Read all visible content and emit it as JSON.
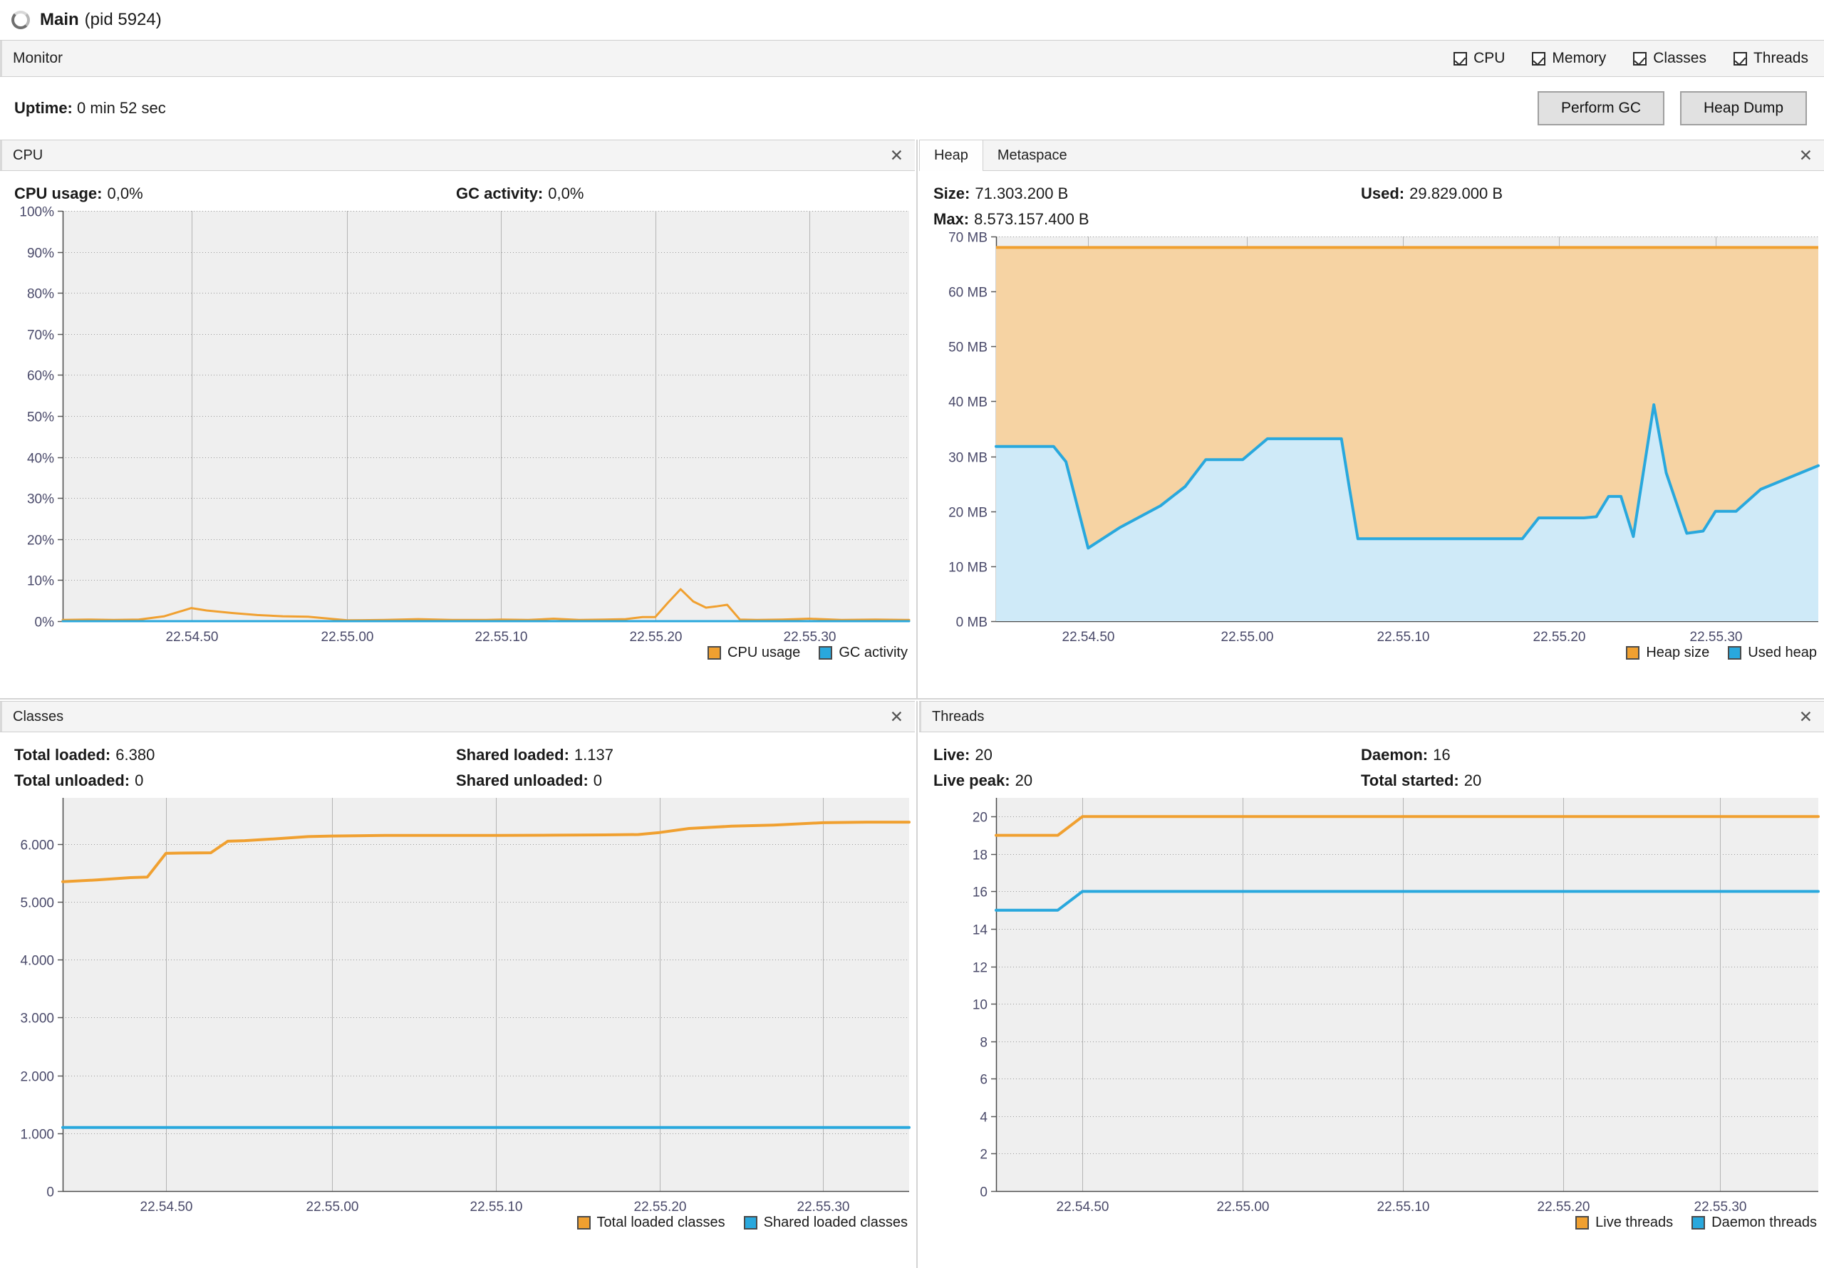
{
  "window": {
    "process_name": "Main",
    "pid_label": "(pid 5924)",
    "app_icon": "process-icon"
  },
  "toolbar": {
    "tab_label": "Monitor",
    "checkboxes": [
      {
        "label": "CPU",
        "checked": true
      },
      {
        "label": "Memory",
        "checked": true
      },
      {
        "label": "Classes",
        "checked": true
      },
      {
        "label": "Threads",
        "checked": true
      }
    ]
  },
  "uptime": {
    "label": "Uptime:",
    "value": "0 min 52 sec"
  },
  "actions": {
    "perform_gc": "Perform GC",
    "heap_dump": "Heap Dump"
  },
  "colors": {
    "orange_line": "#f0a030",
    "orange_fill": "#f6d3a3",
    "blue_line": "#29a8dd",
    "blue_fill": "#cfeaf8",
    "plot_bg": "#efefef",
    "grid": "#bbbbbb",
    "axis_text": "#4a4a6a"
  },
  "panels": {
    "cpu": {
      "title": "CPU",
      "close_icon": "close-icon",
      "stats": [
        {
          "label": "CPU usage:",
          "value": "0,0%"
        },
        {
          "label": "GC activity:",
          "value": "0,0%"
        }
      ],
      "legend": [
        {
          "label": "CPU usage",
          "color": "#f0a030"
        },
        {
          "label": "GC activity",
          "color": "#29a8dd"
        }
      ]
    },
    "heap": {
      "tabs": [
        {
          "label": "Heap",
          "active": true
        },
        {
          "label": "Metaspace",
          "active": false
        }
      ],
      "close_icon": "close-icon",
      "stats": [
        {
          "label": "Size:",
          "value": "71.303.200 B"
        },
        {
          "label": "Used:",
          "value": "29.829.000 B"
        },
        {
          "label": "Max:",
          "value": "8.573.157.400 B"
        }
      ],
      "legend": [
        {
          "label": "Heap size",
          "color": "#f0a030"
        },
        {
          "label": "Used heap",
          "color": "#29a8dd"
        }
      ]
    },
    "classes": {
      "title": "Classes",
      "close_icon": "close-icon",
      "stats": [
        {
          "label": "Total loaded:",
          "value": "6.380"
        },
        {
          "label": "Shared loaded:",
          "value": "1.137"
        },
        {
          "label": "Total unloaded:",
          "value": "0"
        },
        {
          "label": "Shared unloaded:",
          "value": "0"
        }
      ],
      "legend": [
        {
          "label": "Total loaded classes",
          "color": "#f0a030"
        },
        {
          "label": "Shared loaded classes",
          "color": "#29a8dd"
        }
      ]
    },
    "threads": {
      "title": "Threads",
      "close_icon": "close-icon",
      "stats": [
        {
          "label": "Live:",
          "value": "20"
        },
        {
          "label": "Daemon:",
          "value": "16"
        },
        {
          "label": "Live peak:",
          "value": "20"
        },
        {
          "label": "Total started:",
          "value": "20"
        }
      ],
      "legend": [
        {
          "label": "Live threads",
          "color": "#f0a030"
        },
        {
          "label": "Daemon threads",
          "color": "#29a8dd"
        }
      ]
    }
  },
  "chart_data": [
    {
      "id": "cpu",
      "type": "area",
      "title": "CPU",
      "xlabel": "",
      "ylabel": "",
      "ylim": [
        0,
        100
      ],
      "yticks": [
        0,
        10,
        20,
        30,
        40,
        50,
        60,
        70,
        80,
        90,
        100
      ],
      "ytick_labels": [
        "0%",
        "10%",
        "20%",
        "30%",
        "40%",
        "50%",
        "60%",
        "70%",
        "80%",
        "90%",
        "100%"
      ],
      "xtick_labels": [
        "22.54.50",
        "22.55.00",
        "22.55.10",
        "22.55.20",
        "22.55.30"
      ],
      "xtick_positions": [
        0.152,
        0.336,
        0.518,
        0.7,
        0.882
      ],
      "grid": true,
      "legend_position": "bottom-right",
      "series": [
        {
          "name": "CPU usage",
          "color": "#f0a030",
          "x": [
            0.0,
            0.03,
            0.06,
            0.09,
            0.12,
            0.152,
            0.17,
            0.2,
            0.23,
            0.26,
            0.29,
            0.336,
            0.38,
            0.42,
            0.46,
            0.5,
            0.518,
            0.55,
            0.58,
            0.61,
            0.64,
            0.665,
            0.685,
            0.7,
            0.715,
            0.73,
            0.745,
            0.76,
            0.772,
            0.785,
            0.8,
            0.82,
            0.85,
            0.882,
            0.92,
            0.96,
            1.0
          ],
          "values": [
            0.3,
            0.4,
            0.3,
            0.4,
            1.2,
            3.2,
            2.6,
            2.0,
            1.5,
            1.2,
            1.1,
            0.2,
            0.3,
            0.5,
            0.3,
            0.3,
            0.4,
            0.3,
            0.6,
            0.3,
            0.4,
            0.5,
            1.0,
            1.0,
            4.5,
            7.8,
            4.8,
            3.3,
            3.6,
            4.0,
            0.4,
            0.3,
            0.4,
            0.6,
            0.3,
            0.4,
            0.3
          ]
        },
        {
          "name": "GC activity",
          "color": "#29a8dd",
          "x": [
            0.0,
            1.0
          ],
          "values": [
            0.0,
            0.0
          ]
        }
      ]
    },
    {
      "id": "heap",
      "type": "area",
      "title": "Heap",
      "xlabel": "",
      "ylabel": "",
      "ylim": [
        0,
        70
      ],
      "yticks": [
        0,
        10,
        20,
        30,
        40,
        50,
        60,
        70
      ],
      "ytick_labels": [
        "0 MB",
        "10 MB",
        "20 MB",
        "30 MB",
        "40 MB",
        "50 MB",
        "60 MB",
        "70 MB"
      ],
      "xtick_labels": [
        "22.54.50",
        "22.55.00",
        "22.55.10",
        "22.55.20",
        "22.55.30"
      ],
      "xtick_positions": [
        0.112,
        0.305,
        0.495,
        0.685,
        0.875
      ],
      "grid": true,
      "legend_position": "bottom-right",
      "series": [
        {
          "name": "Heap size",
          "color": "#f0a030",
          "fill": "#f6d3a3",
          "x": [
            0.0,
            1.0
          ],
          "values": [
            68.0,
            68.0
          ]
        },
        {
          "name": "Used heap",
          "color": "#29a8dd",
          "fill": "#cfeaf8",
          "x": [
            0.0,
            0.07,
            0.085,
            0.112,
            0.15,
            0.2,
            0.23,
            0.255,
            0.3,
            0.33,
            0.345,
            0.42,
            0.43,
            0.44,
            0.495,
            0.53,
            0.56,
            0.64,
            0.66,
            0.685,
            0.7,
            0.715,
            0.73,
            0.745,
            0.76,
            0.775,
            0.8,
            0.815,
            0.84,
            0.86,
            0.875,
            0.9,
            0.93,
            1.0
          ],
          "values": [
            31.8,
            31.8,
            29.0,
            13.3,
            17.0,
            21.0,
            24.5,
            29.4,
            29.4,
            33.2,
            33.2,
            33.2,
            24.0,
            15.0,
            15.0,
            15.0,
            15.0,
            15.0,
            18.8,
            18.8,
            18.8,
            18.8,
            19.0,
            22.7,
            22.7,
            15.4,
            39.4,
            27.0,
            16.0,
            16.4,
            20.0,
            20.0,
            24.0,
            28.3
          ]
        }
      ]
    },
    {
      "id": "classes",
      "type": "line",
      "title": "Classes",
      "xlabel": "",
      "ylabel": "",
      "ylim": [
        0,
        6800
      ],
      "yticks": [
        0,
        1000,
        2000,
        3000,
        4000,
        5000,
        6000
      ],
      "ytick_labels": [
        "0",
        "1.000",
        "2.000",
        "3.000",
        "4.000",
        "5.000",
        "6.000"
      ],
      "xtick_labels": [
        "22.54.50",
        "22.55.00",
        "22.55.10",
        "22.55.20",
        "22.55.30"
      ],
      "xtick_positions": [
        0.122,
        0.318,
        0.512,
        0.705,
        0.898
      ],
      "grid": true,
      "legend_position": "bottom-right",
      "series": [
        {
          "name": "Total loaded classes",
          "color": "#f0a030",
          "x": [
            0.0,
            0.04,
            0.08,
            0.1,
            0.122,
            0.14,
            0.175,
            0.195,
            0.215,
            0.25,
            0.29,
            0.318,
            0.38,
            0.44,
            0.512,
            0.58,
            0.64,
            0.68,
            0.705,
            0.74,
            0.79,
            0.84,
            0.898,
            0.95,
            1.0
          ],
          "values": [
            5350,
            5380,
            5420,
            5430,
            5840,
            5845,
            5850,
            6050,
            6060,
            6090,
            6130,
            6140,
            6150,
            6150,
            6150,
            6155,
            6160,
            6165,
            6200,
            6270,
            6310,
            6330,
            6370,
            6380,
            6380
          ]
        },
        {
          "name": "Shared loaded classes",
          "color": "#29a8dd",
          "x": [
            0.0,
            1.0
          ],
          "values": [
            1100,
            1100
          ]
        }
      ]
    },
    {
      "id": "threads",
      "type": "line",
      "title": "Threads",
      "xlabel": "",
      "ylabel": "",
      "ylim": [
        0,
        21
      ],
      "yticks": [
        0,
        2,
        4,
        6,
        8,
        10,
        12,
        14,
        16,
        18,
        20
      ],
      "ytick_labels": [
        "0",
        "2",
        "4",
        "6",
        "8",
        "10",
        "12",
        "14",
        "16",
        "18",
        "20"
      ],
      "xtick_labels": [
        "22.54.50",
        "22.55.00",
        "22.55.10",
        "22.55.20",
        "22.55.30"
      ],
      "xtick_positions": [
        0.105,
        0.3,
        0.495,
        0.69,
        0.88
      ],
      "grid": true,
      "legend_position": "bottom-right",
      "series": [
        {
          "name": "Live threads",
          "color": "#f0a030",
          "x": [
            0.0,
            0.075,
            0.105,
            1.0
          ],
          "values": [
            19,
            19,
            20,
            20
          ]
        },
        {
          "name": "Daemon threads",
          "color": "#29a8dd",
          "x": [
            0.0,
            0.075,
            0.105,
            1.0
          ],
          "values": [
            15,
            15,
            16,
            16
          ]
        }
      ]
    }
  ]
}
